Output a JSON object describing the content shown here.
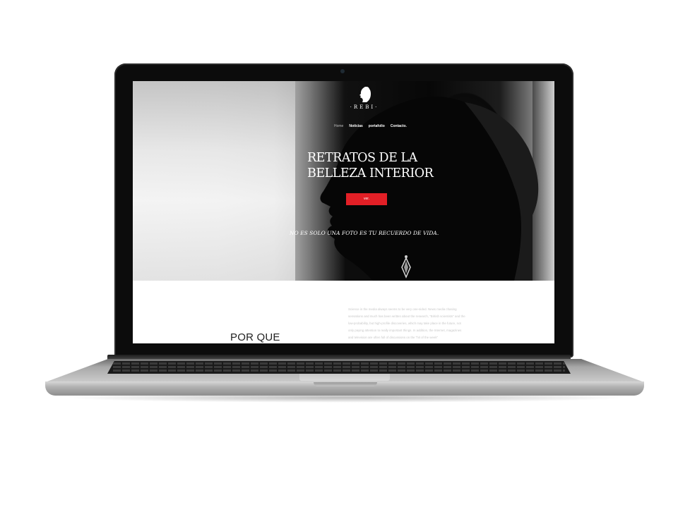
{
  "site": {
    "logo_text": "·REBI·",
    "nav": [
      "Home",
      "Noticias",
      "portafolio",
      "Contacto."
    ],
    "hero": {
      "headline_line1": "RETRATOS DE LA",
      "headline_line2": "BELLEZA INTERIOR",
      "cta_label": "ver.",
      "tagline": "NO ES SOLO UNA FOTO ES TU RECUERDO DE VIDA."
    },
    "section": {
      "title": "POR QUE",
      "body": "Science in the media always seems to be very one-sided. News media chasing sensations and much has been written about the research, \"British scientists\" and the low-probability, but high-profile discoveries, which may take place in the future, not only paying attention to really important things. In addition, the Internet, magazines and television are often full of discussions on the \"hit of the week\""
    }
  },
  "colors": {
    "accent_red": "#e21f26",
    "hero_dark": "#0a0a0a",
    "text_light": "#ffffff"
  }
}
